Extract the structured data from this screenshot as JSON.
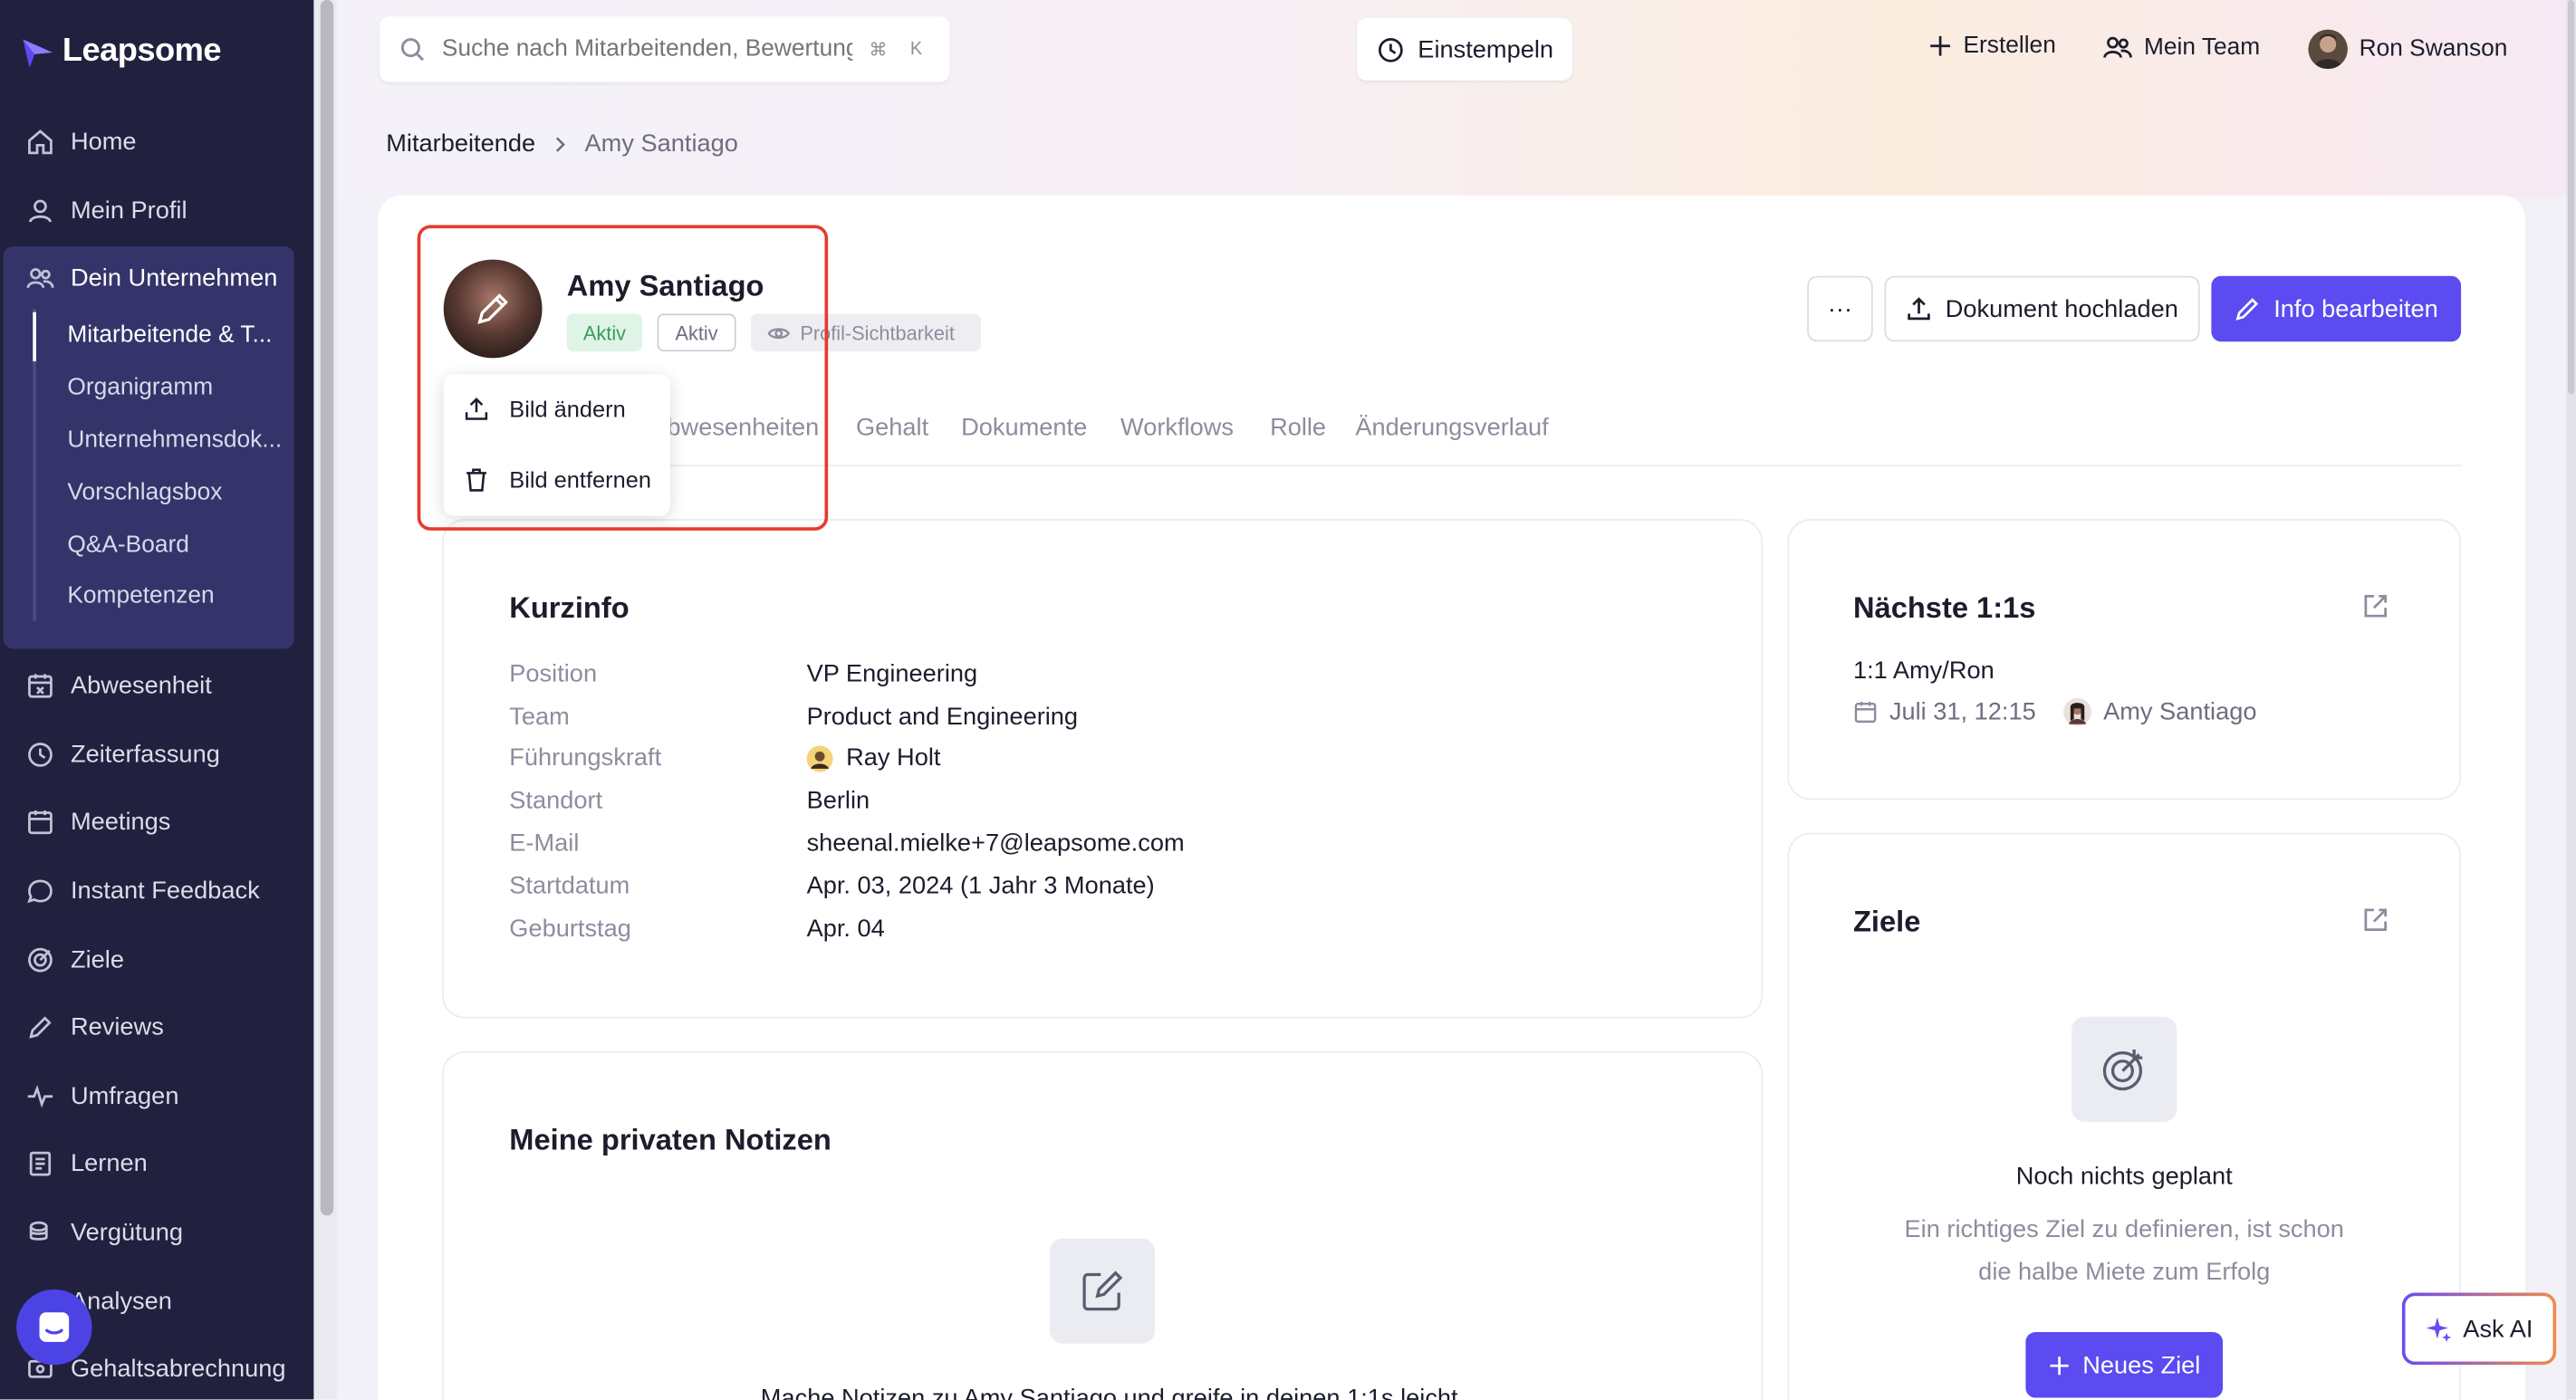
{
  "app": {
    "name": "Leapsome"
  },
  "colors": {
    "accent": "#5b4bf0",
    "sidebar": "#21213f",
    "highlight": "#e53b2f",
    "active_badge": "#3c9a5f"
  },
  "sidebar": {
    "items": [
      {
        "label": "Home",
        "icon": "home-icon"
      },
      {
        "label": "Mein Profil",
        "icon": "user-icon"
      },
      {
        "label": "Dein Unternehmen",
        "icon": "users-icon"
      },
      {
        "label": "Abwesenheit",
        "icon": "calendar-x-icon"
      },
      {
        "label": "Zeiterfassung",
        "icon": "clock-icon"
      },
      {
        "label": "Meetings",
        "icon": "calendar-icon"
      },
      {
        "label": "Instant Feedback",
        "icon": "chat-icon"
      },
      {
        "label": "Ziele",
        "icon": "target-icon"
      },
      {
        "label": "Reviews",
        "icon": "pen-icon"
      },
      {
        "label": "Umfragen",
        "icon": "pulse-icon"
      },
      {
        "label": "Lernen",
        "icon": "book-icon"
      },
      {
        "label": "Vergütung",
        "icon": "coins-icon"
      },
      {
        "label": "Analysen",
        "icon": "chart-icon"
      },
      {
        "label": "Gehaltsabrechnung",
        "icon": "payroll-icon"
      }
    ],
    "company_sub": [
      "Mitarbeitende & T...",
      "Organigramm",
      "Unternehmensdok...",
      "Vorschlagsbox",
      "Q&A-Board",
      "Kompetenzen"
    ]
  },
  "topbar": {
    "search_placeholder": "Suche nach Mitarbeitenden, Bewertungen",
    "kbd_1": "⌘",
    "kbd_2": "K",
    "clock_in": "Einstempeln",
    "create": "Erstellen",
    "my_team": "Mein Team",
    "user_name": "Ron Swanson"
  },
  "breadcrumb": {
    "parent": "Mitarbeitende",
    "current": "Amy Santiago"
  },
  "profile": {
    "name": "Amy Santiago",
    "badge_status": "Aktiv",
    "badge_status_2": "Aktiv",
    "badge_visibility": "Profil-Sichtbarkeit",
    "more": "···",
    "upload_doc": "Dokument hochladen",
    "edit_info": "Info bearbeiten"
  },
  "photo_menu": {
    "change": "Bild ändern",
    "remove": "Bild entfernen"
  },
  "tabs": [
    "Abwesenheiten",
    "Gehalt",
    "Dokumente",
    "Workflows",
    "Rolle",
    "Änderungsverlauf"
  ],
  "kurzinfo": {
    "title": "Kurzinfo",
    "rows": [
      {
        "label": "Position",
        "value": "VP Engineering"
      },
      {
        "label": "Team",
        "value": "Product and Engineering"
      },
      {
        "label": "Führungskraft",
        "value": "Ray Holt"
      },
      {
        "label": "Standort",
        "value": "Berlin"
      },
      {
        "label": "E-Mail",
        "value": "sheenal.mielke+7@leapsome.com"
      },
      {
        "label": "Startdatum",
        "value": "Apr. 03, 2024 (1 Jahr 3 Monate)"
      },
      {
        "label": "Geburtstag",
        "value": "Apr. 04"
      }
    ]
  },
  "notes": {
    "title": "Meine privaten Notizen",
    "text": "Mache Notizen zu Amy Santiago und greife in deinen 1:1s leicht"
  },
  "one_on_ones": {
    "title": "Nächste 1:1s",
    "meeting_title": "1:1 Amy/Ron",
    "date": "Juli 31, 12:15",
    "person": "Amy Santiago"
  },
  "goals": {
    "title": "Ziele",
    "empty_title": "Noch nichts geplant",
    "empty_line_1": "Ein richtiges Ziel zu definieren, ist schon",
    "empty_line_2": "die halbe Miete zum Erfolg",
    "new_goal": "Neues Ziel"
  },
  "ask_ai": "Ask AI"
}
